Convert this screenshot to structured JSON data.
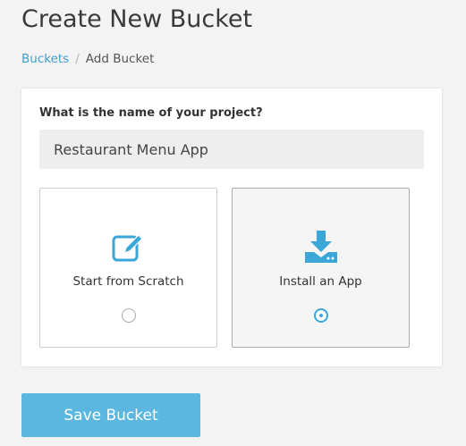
{
  "header": {
    "title": "Create New Bucket"
  },
  "breadcrumb": {
    "items": [
      {
        "label": "Buckets"
      },
      {
        "label": "Add Bucket"
      }
    ],
    "separator": "/"
  },
  "form": {
    "project_label": "What is the name of your project?",
    "project_value": "Restaurant Menu App",
    "options": [
      {
        "label": "Start from Scratch",
        "icon": "edit-icon",
        "selected": false
      },
      {
        "label": "Install an App",
        "icon": "download-icon",
        "selected": true
      }
    ],
    "save_label": "Save Bucket"
  },
  "colors": {
    "accent": "#3ba6d8",
    "button": "#5bb7e0",
    "link": "#3b9fd0",
    "background": "#f3f3f3"
  }
}
